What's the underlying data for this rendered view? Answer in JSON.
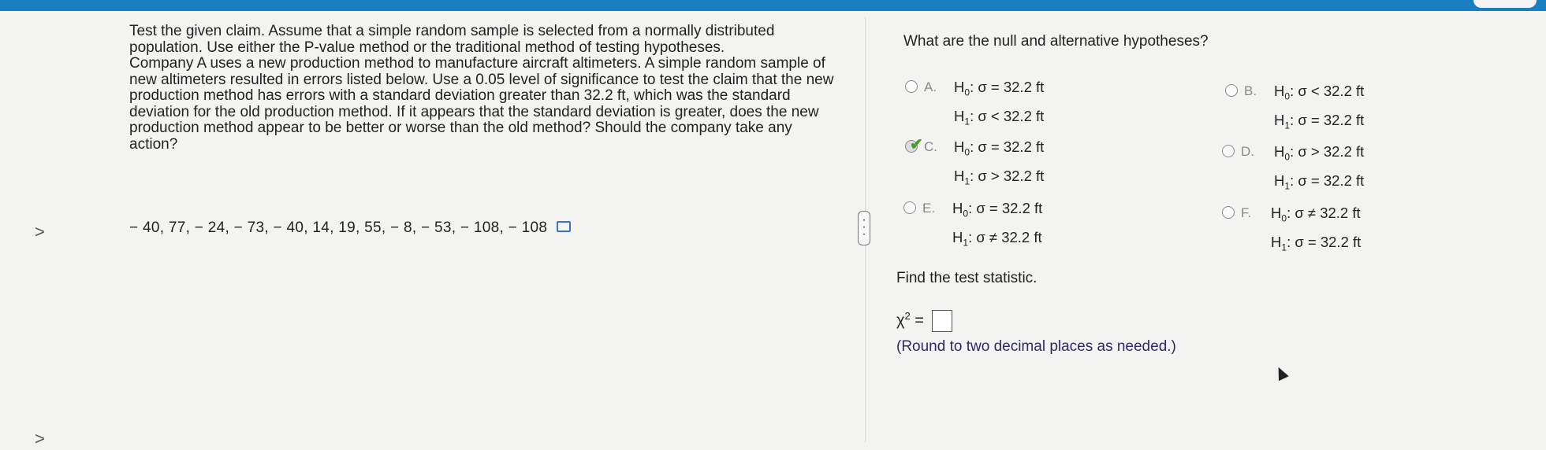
{
  "question": {
    "paragraphs": [
      "Test the given claim. Assume that a simple random sample is selected from a normally distributed population. Use either the P-value method or the traditional method of testing hypotheses.",
      "Company A uses a new production method to manufacture aircraft altimeters. A simple random sample of new altimeters resulted in errors listed below. Use a 0.05 level of significance to test the claim that the new production method has errors with a standard deviation greater than 32.2 ft, which was the standard deviation for the old production method. If it appears that the standard deviation is greater, does the new production method appear to be better or worse than the old method? Should the company take any action?"
    ],
    "data_values": "− 40, 77, − 24, − 73, − 40, 14, 19, 55, − 8, − 53, − 108, − 108"
  },
  "nav": {
    "chevron_1": ">",
    "chevron_2": ">"
  },
  "right": {
    "hypotheses_question": "What are the null and alternative hypotheses?",
    "options": [
      {
        "letter": "A.",
        "h0": "σ = 32.2 ft",
        "h1": "σ < 32.2 ft",
        "selected": false
      },
      {
        "letter": "B.",
        "h0": "σ < 32.2 ft",
        "h1": "σ = 32.2 ft",
        "selected": false
      },
      {
        "letter": "C.",
        "h0": "σ = 32.2 ft",
        "h1": "σ > 32.2 ft",
        "selected": true
      },
      {
        "letter": "D.",
        "h0": "σ > 32.2 ft",
        "h1": "σ = 32.2 ft",
        "selected": false
      },
      {
        "letter": "E.",
        "h0": "σ = 32.2 ft",
        "h1": "σ ≠ 32.2 ft",
        "selected": false
      },
      {
        "letter": "F.",
        "h0": "σ ≠ 32.2 ft",
        "h1": "σ = 32.2 ft",
        "selected": false
      }
    ],
    "h0_label": "H",
    "h0_sub": "0",
    "h1_label": "H",
    "h1_sub": "1",
    "find_text": "Find the test statistic.",
    "chi_label": "χ",
    "chi_sup": "2",
    "chi_eq": " =",
    "chi_value": "",
    "round_text": "(Round to two decimal places as needed.)"
  },
  "colors": {
    "accent": "#1a7fc1",
    "check": "#4a9c2c"
  }
}
